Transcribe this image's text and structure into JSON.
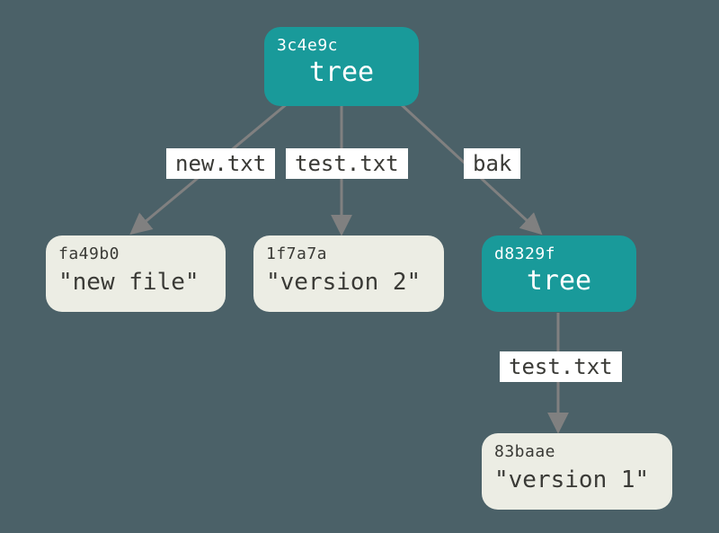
{
  "colors": {
    "background": "#4b6168",
    "tree_fill": "#199a9a",
    "blob_fill": "#ecede4",
    "arrow": "#808080",
    "edge_label_bg": "#ffffff"
  },
  "nodes": {
    "root": {
      "type": "tree",
      "hash": "3c4e9c",
      "label": "tree"
    },
    "blob_new": {
      "type": "blob",
      "hash": "fa49b0",
      "label": "\"new file\""
    },
    "blob_v2": {
      "type": "blob",
      "hash": "1f7a7a",
      "label": "\"version 2\""
    },
    "subtree": {
      "type": "tree",
      "hash": "d8329f",
      "label": "tree"
    },
    "blob_v1": {
      "type": "blob",
      "hash": "83baae",
      "label": "\"version 1\""
    }
  },
  "edges": {
    "e1": {
      "from": "root",
      "to": "blob_new",
      "label": "new.txt"
    },
    "e2": {
      "from": "root",
      "to": "blob_v2",
      "label": "test.txt"
    },
    "e3": {
      "from": "root",
      "to": "subtree",
      "label": "bak"
    },
    "e4": {
      "from": "subtree",
      "to": "blob_v1",
      "label": "test.txt"
    }
  }
}
